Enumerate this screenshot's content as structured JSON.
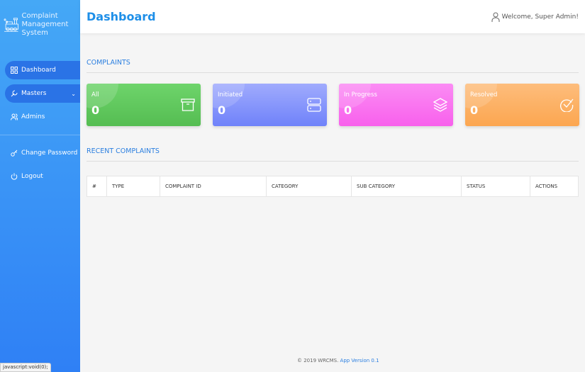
{
  "brand": {
    "name": "Complaint Management System"
  },
  "sidebar": {
    "items": [
      {
        "label": "Dashboard",
        "active": true
      },
      {
        "label": "Masters"
      },
      {
        "label": "Admins"
      },
      {
        "label": "Change Password"
      },
      {
        "label": "Logout"
      }
    ]
  },
  "header": {
    "title": "Dashboard",
    "welcome": "Welcome, Super Admin!"
  },
  "complaints": {
    "heading": "COMPLAINTS",
    "cards": [
      {
        "label": "All",
        "value": "0",
        "color": "#5cc15a"
      },
      {
        "label": "Initiated",
        "value": "0",
        "color": "#7c8ffb"
      },
      {
        "label": "In Progress",
        "value": "0",
        "color": "#f96ef0"
      },
      {
        "label": "Resolved",
        "value": "0",
        "color": "#fdaa5e"
      }
    ]
  },
  "recent": {
    "heading": "RECENT COMPLAINTS",
    "columns": [
      "#",
      "TYPE",
      "COMPLAINT ID",
      "CATEGORY",
      "SUB CATEGORY",
      "STATUS",
      "ACTIONS"
    ]
  },
  "footer": {
    "copyright": "© 2019 WRCMS.",
    "version": "App Version 0.1"
  },
  "statusbar": "javascript:void(0);"
}
